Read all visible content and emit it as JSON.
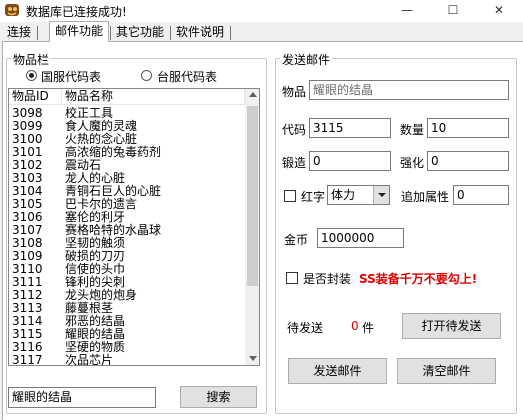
{
  "window": {
    "title": "数据库已连接成功!",
    "minimize": "—",
    "maximize": "☐",
    "close": "✕"
  },
  "tabs": [
    "连接",
    "邮件功能",
    "其它功能",
    "软件说明"
  ],
  "item_panel": {
    "legend": "物品栏",
    "radio_cn": "国服代码表",
    "radio_tw": "台服代码表",
    "selected": "cn",
    "columns": [
      "物品ID",
      "物品名称"
    ],
    "rows": [
      [
        "3098",
        "校正工具"
      ],
      [
        "3099",
        "食人魔的灵魂"
      ],
      [
        "3100",
        "火热的念心脏"
      ],
      [
        "3101",
        "高浓缩的兔毒药剂"
      ],
      [
        "3102",
        "震动石"
      ],
      [
        "3103",
        "龙人的心脏"
      ],
      [
        "3104",
        "青铜石巨人的心脏"
      ],
      [
        "3105",
        "巴卡尔的遗言"
      ],
      [
        "3106",
        "塞伦的利牙"
      ],
      [
        "3107",
        "赛格哈特的水晶球"
      ],
      [
        "3108",
        "坚韧的触须"
      ],
      [
        "3109",
        "破损的刀刃"
      ],
      [
        "3110",
        "信使的头巾"
      ],
      [
        "3111",
        "锋利的尖刺"
      ],
      [
        "3112",
        "龙头炮的炮身"
      ],
      [
        "3113",
        "藤蔓根茎"
      ],
      [
        "3114",
        "邪恶的结晶"
      ],
      [
        "3115",
        "耀眼的结晶"
      ],
      [
        "3116",
        "坚硬的物质"
      ],
      [
        "3117",
        "次品芯片"
      ]
    ],
    "search_value": "耀眼的结晶",
    "search_button": "搜索"
  },
  "mail_panel": {
    "legend": "发送邮件",
    "item_label": "物品",
    "item_value": "耀眼的结晶",
    "code_label": "代码",
    "code_value": "3115",
    "qty_label": "数量",
    "qty_value": "10",
    "forge_label": "锻造",
    "forge_value": "0",
    "enhance_label": "强化",
    "enhance_value": "0",
    "red_label": "红字",
    "stat_select": "体力",
    "extra_label": "追加属性",
    "extra_value": "0",
    "gold_label": "金币",
    "gold_value": "1000000",
    "seal_label": "是否封装",
    "seal_warning": "SS装备千万不要勾上!",
    "pending_label": "待发送",
    "pending_count": "0",
    "pending_unit": "件",
    "open_pending_button": "打开待发送",
    "send_button": "发送邮件",
    "clear_button": "清空邮件"
  },
  "colors": {
    "warning_red": "#e00000"
  }
}
